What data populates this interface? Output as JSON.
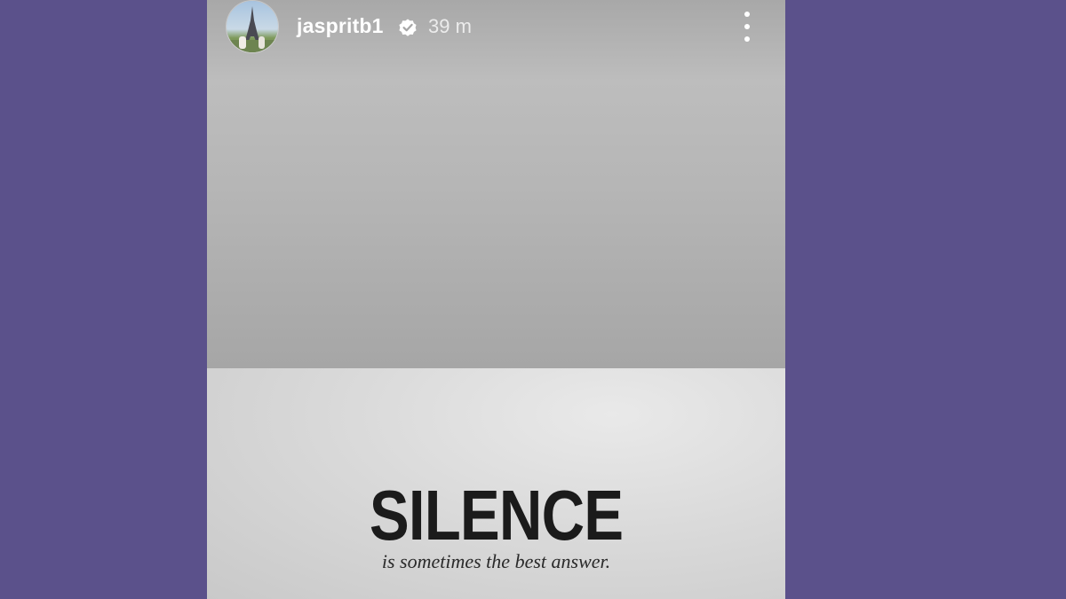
{
  "story": {
    "header": {
      "username": "jaspritb1",
      "verified": true,
      "time_ago": "39 m",
      "avatar_icon": "eiffel-tower-photo",
      "verified_icon": "verified-badge-icon",
      "more_icon": "more-vertical-icon"
    },
    "content": {
      "title": "SILENCE",
      "subtitle": "is sometimes the best answer."
    }
  },
  "colors": {
    "page_background": "#5b518b",
    "title_text": "#1b1b1b",
    "header_text": "#ffffff"
  }
}
